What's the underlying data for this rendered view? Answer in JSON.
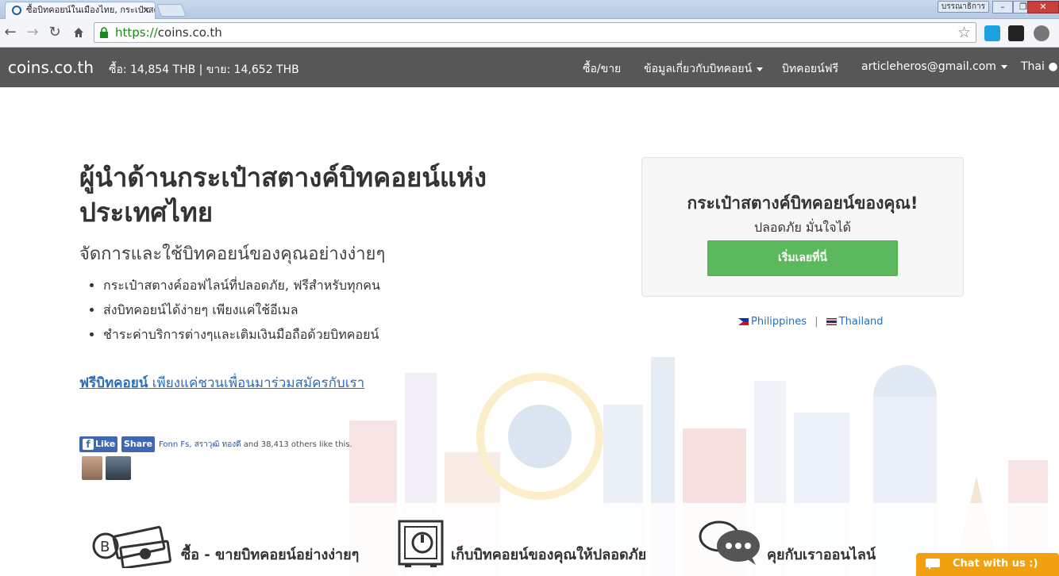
{
  "browser": {
    "tab_title": "ซื้อบิทคอยน์ในเมืองไทย, กระเป๋าสตางค์บิทคอยน์",
    "tab_close": "✕",
    "profile_label": "บรรณาธิการ",
    "url_scheme": "https://",
    "url_host": "coins.co.th",
    "window_minimize": "–",
    "window_restore": "❐",
    "window_close": "✕"
  },
  "header": {
    "brand": "coins.co.th",
    "price_text": "ซื้อ: 14,854 THB | ขาย: 14,652 THB",
    "nav": {
      "buy_sell": "ซื้อ/ขาย",
      "about": "ข้อมูลเกี่ยวกับบิทคอยน์",
      "free_bitcoin": "บิทคอยน์ฟรี",
      "account": "articleheros@gmail.com",
      "language": "Thai"
    }
  },
  "hero": {
    "title": "ผู้นำด้านกระเป๋าสตางค์บิทคอยน์แห่งประเทศไทย",
    "subtitle": "จัดการและใช้บิทคอยน์ของคุณอย่างง่ายๆ",
    "bullets": [
      "กระเป๋าสตางค์ออฟไลน์ที่ปลอดภัย, ฟรีสำหรับทุกคน",
      "ส่งบิทคอยน์ได้ง่ายๆ เพียงแค่ใช้อีเมล",
      "ชำระค่าบริการต่างๆและเติมเงินมือถือด้วยบิทคอยน์"
    ],
    "referral_bold": "ฟรีบิทคอยน์",
    "referral_rest": " เพียงแค่ชวนเพื่อนมาร่วมสมัครกับเรา"
  },
  "facebook": {
    "like": "Like",
    "share": "Share",
    "names": "Fonn Fs, สราวุฒิ ทองดี",
    "others": " and 38,413 others like this."
  },
  "cta": {
    "title": "กระเป๋าสตางค์บิทคอยน์ของคุณ!",
    "subtitle": "ปลอดภัย มั่นใจได้",
    "button": "เริ่มเลยที่นี่"
  },
  "countries": {
    "philippines": "Philippines",
    "separator": "|",
    "thailand": "Thailand"
  },
  "features": {
    "buy_sell": "ซื้อ - ขายบิทคอยน์อย่างง่ายๆ",
    "secure": "เก็บบิทคอยน์ของคุณให้ปลอดภัย",
    "chat": "คุยกับเราออนไลน์"
  },
  "chat_widget": {
    "label": "Chat with us :)"
  },
  "colors": {
    "header_bg": "#575757",
    "cta_green": "#5cb85c",
    "link_blue": "#2a6ebb",
    "chat_orange": "#f0a010"
  }
}
